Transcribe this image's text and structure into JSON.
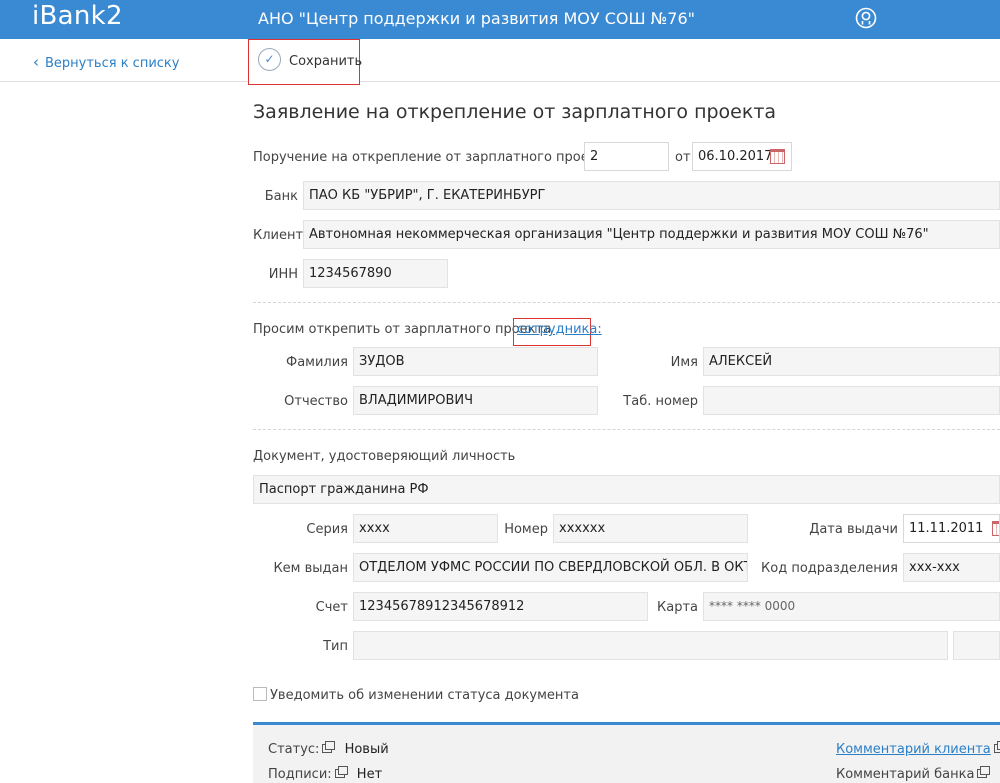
{
  "header": {
    "logo": "iBank2",
    "org_title": "АНО \"Центр поддержки и развития МОУ СОШ №76\""
  },
  "toolbar": {
    "back_label": "Вернуться к списку",
    "save_label": "Сохранить"
  },
  "form": {
    "title": "Заявление на открепление от зарплатного проекта",
    "order_label": "Поручение на открепление от зарплатного проекта N",
    "order_number": "2",
    "date_label": "от",
    "date": "06.10.2017",
    "bank_label": "Банк",
    "bank": "ПАО КБ \"УБРИР\", Г. ЕКАТЕРИНБУРГ",
    "client_label": "Клиент",
    "client": "Автономная некоммерческая организация \"Центр поддержки и развития МОУ СОШ №76\"",
    "inn_label": "ИНН",
    "inn": "1234567890",
    "request_text": "Просим открепить от зарплатного проекта",
    "employee_link": "сотрудника:",
    "surname_label": "Фамилия",
    "surname": "ЗУДОВ",
    "name_label": "Имя",
    "name": "АЛЕКСЕЙ",
    "patronymic_label": "Отчество",
    "patronymic": "ВЛАДИМИРОВИЧ",
    "tab_label": "Таб. номер",
    "tab_number": "",
    "doc_section": "Документ, удостоверяющий личность",
    "doc_type": "Паспорт гражданина РФ",
    "series_label": "Серия",
    "series": "xxxx",
    "number_label": "Номер",
    "number": "xxxxxx",
    "issue_date_label": "Дата выдачи",
    "issue_date": "11.11.2011",
    "issued_by_label": "Кем выдан",
    "issued_by": "ОТДЕЛОМ УФМС РОССИИ ПО СВЕРДЛОВСКОЙ ОБЛ. В ОКТЯБРЬСКОМ",
    "code_label": "Код подразделения",
    "code": "xxx-xxx",
    "account_label": "Счет",
    "account": "12345678912345678912",
    "card_label": "Карта",
    "card": "**** **** 0000",
    "type_label": "Тип",
    "type_value": "",
    "notify_label": "Уведомить об изменении статуса документа",
    "notify_checked": false
  },
  "footer": {
    "status_label": "Статус:",
    "status_value": "Новый",
    "signatures_label": "Подписи:",
    "signatures_value": "Нет",
    "client_comment": "Комментарий клиента",
    "bank_comment": "Комментарий банка"
  }
}
